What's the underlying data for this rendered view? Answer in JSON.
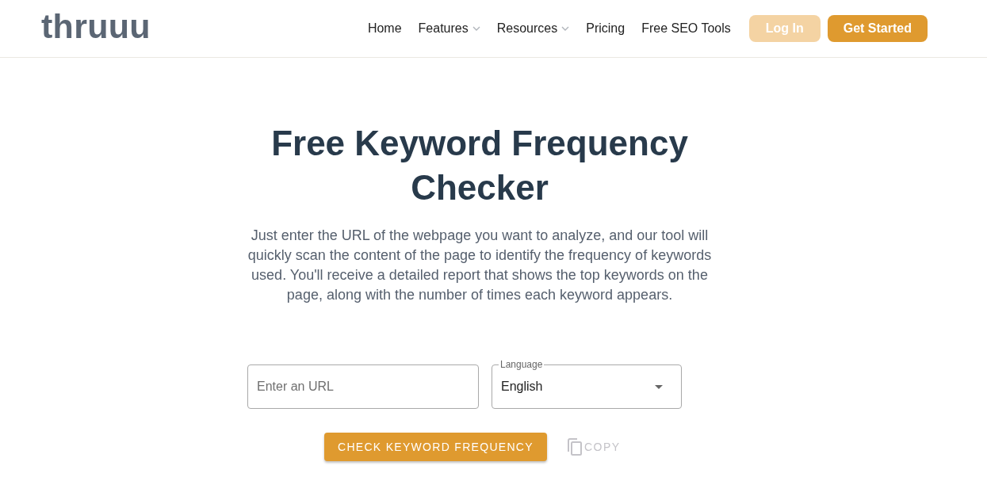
{
  "header": {
    "logo": "thruuu",
    "nav": [
      {
        "label": "Home",
        "kind": "link"
      },
      {
        "label": "Features",
        "kind": "dropdown"
      },
      {
        "label": "Resources",
        "kind": "dropdown"
      },
      {
        "label": "Pricing",
        "kind": "link"
      },
      {
        "label": "Free SEO Tools",
        "kind": "link"
      }
    ],
    "buttons": [
      {
        "label": "Log In",
        "kind": "light"
      },
      {
        "label": "Get Started",
        "kind": "primary"
      }
    ]
  },
  "hero": {
    "title": "Free Keyword Frequency Checker",
    "description": "Just enter the URL of the webpage you want to analyze, and our tool will quickly scan the content of the page to identify the frequency of keywords used. You'll receive a detailed report that shows the top keywords on the page, along with the number of times each keyword appears."
  },
  "form": {
    "url_field": {
      "placeholder": "Enter an URL"
    },
    "language_select": {
      "label": "Language",
      "value": "English"
    },
    "submit_button": "CHECK KEYWORD FREQUENCY",
    "copy_button": {
      "label": "COPY",
      "disabled": true
    }
  }
}
